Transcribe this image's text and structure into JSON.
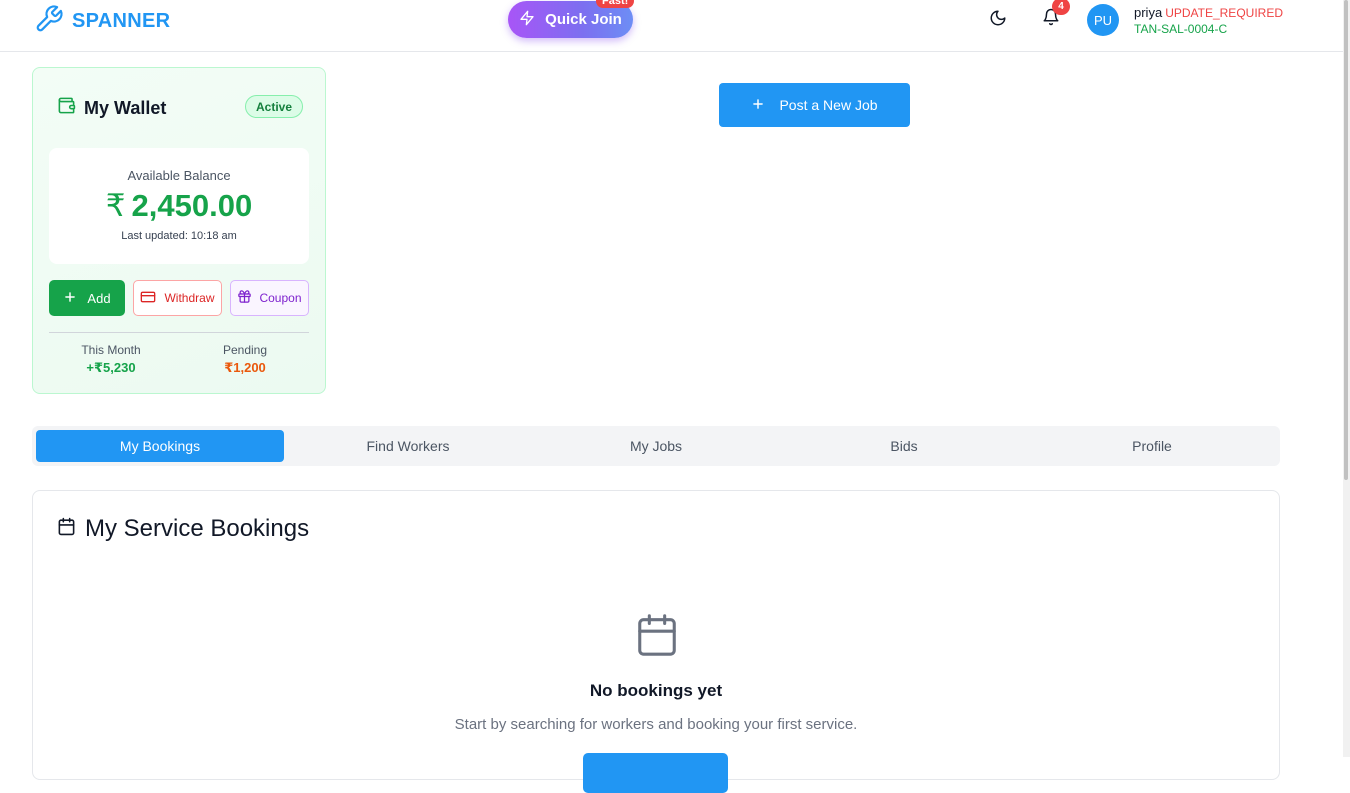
{
  "header": {
    "logo_text": "SPANNER",
    "quick_join_label": "Quick Join",
    "fast_badge": "Fast!",
    "notification_count": "4",
    "avatar_initials": "PU",
    "user_name": "priya",
    "user_status": "UPDATE_REQUIRED",
    "user_code": "TAN-SAL-0004-C"
  },
  "wallet": {
    "title": "My Wallet",
    "status": "Active",
    "balance_label": "Available Balance",
    "currency_symbol": "₹",
    "balance": "2,450.00",
    "last_updated": "Last updated: 10:18 am",
    "add_label": "Add",
    "withdraw_label": "Withdraw",
    "coupon_label": "Coupon",
    "this_month_label": "This Month",
    "this_month_value": "+₹5,230",
    "pending_label": "Pending",
    "pending_value": "₹1,200"
  },
  "post_job_label": "Post a New Job",
  "tabs": [
    {
      "label": "My Bookings",
      "active": true
    },
    {
      "label": "Find Workers",
      "active": false
    },
    {
      "label": "My Jobs",
      "active": false
    },
    {
      "label": "Bids",
      "active": false
    },
    {
      "label": "Profile",
      "active": false
    }
  ],
  "bookings": {
    "title": "My Service Bookings",
    "empty_title": "No bookings yet",
    "empty_desc": "Start by searching for workers and booking your first service."
  },
  "colors": {
    "primary": "#2196f3",
    "success": "#16a34a",
    "danger": "#ef4444",
    "warning": "#ea580c",
    "purple": "#7e22ce"
  },
  "icons": {
    "logo": "wrench-icon",
    "quick_join": "zap-icon",
    "theme": "moon-icon",
    "notifications": "bell-icon",
    "wallet": "wallet-icon",
    "add": "plus-icon",
    "withdraw": "credit-card-icon",
    "coupon": "gift-icon",
    "post_job": "plus-icon",
    "bookings": "calendar-icon"
  }
}
